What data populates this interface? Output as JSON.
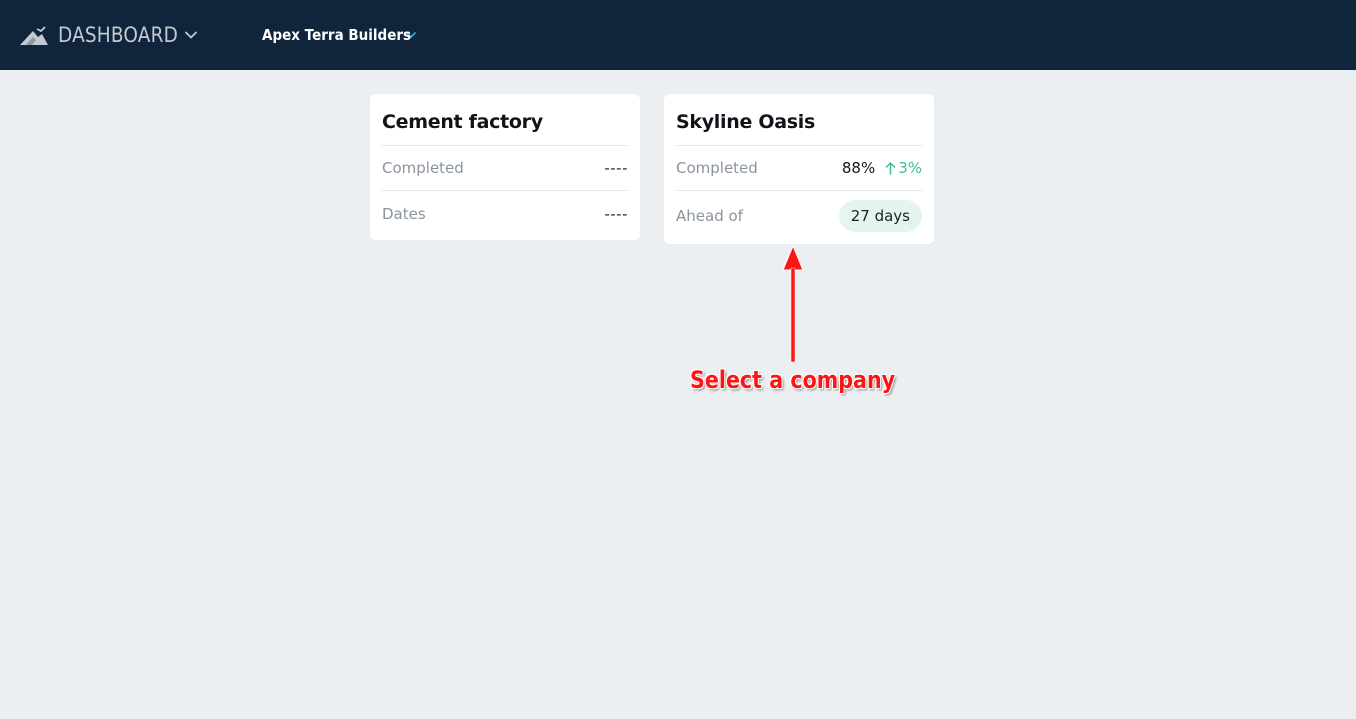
{
  "header": {
    "app_title": "DASHBOARD",
    "logo_icon": "mountain-logo-icon",
    "menu_chevron_icon": "chevron-down-icon",
    "company_selector": "Apex Terra Builders",
    "company_chevron_icon": "chevron-down-icon",
    "colors": {
      "background": "#10243b",
      "title": "#c2cad3",
      "chevron_accent": "#3ea9e0"
    }
  },
  "projects": [
    {
      "name": "Cement factory",
      "rows": [
        {
          "label": "Completed",
          "value": "----"
        },
        {
          "label": "Dates",
          "value": "----"
        }
      ]
    },
    {
      "name": "Skyline Oasis",
      "completed_label": "Completed",
      "completed_value": "88%",
      "trend_icon": "arrow-up-icon",
      "trend_value": "3%",
      "schedule_label": "Ahead of",
      "schedule_value": "27 days",
      "colors": {
        "trend": "#3fbf8f",
        "badge": "#e4f5ef"
      }
    }
  ],
  "annotation": {
    "text": "Select a company",
    "arrow_icon": "arrow-up-icon",
    "color": "#ff1414"
  }
}
